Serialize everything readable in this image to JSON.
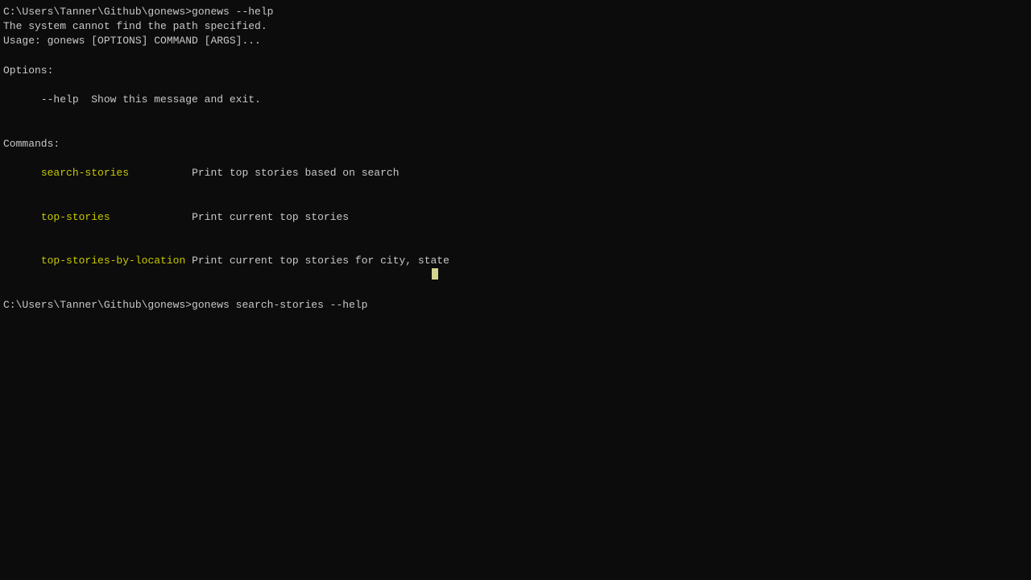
{
  "terminal": {
    "background": "#0c0c0c",
    "lines": [
      {
        "id": "line1",
        "type": "prompt",
        "text": "C:\\Users\\Tanner\\Github\\gonews>gonews --help",
        "color": "white"
      },
      {
        "id": "line2",
        "type": "output",
        "text": "The system cannot find the path specified.",
        "color": "white"
      },
      {
        "id": "line3",
        "type": "output",
        "text": "Usage: gonews [OPTIONS] COMMAND [ARGS]...",
        "color": "white"
      },
      {
        "id": "line4",
        "type": "empty"
      },
      {
        "id": "line5",
        "type": "output",
        "text": "Options:",
        "color": "white"
      },
      {
        "id": "line6",
        "type": "option",
        "flag": "--help",
        "desc": "Show this message and exit.",
        "color": "white"
      },
      {
        "id": "line7",
        "type": "empty"
      },
      {
        "id": "line8",
        "type": "output",
        "text": "Commands:",
        "color": "white"
      },
      {
        "id": "cmd1",
        "type": "command",
        "name": "search-stories",
        "desc": "Print top stories based on search",
        "name_color": "yellow",
        "desc_color": "white"
      },
      {
        "id": "cmd2",
        "type": "command",
        "name": "top-stories",
        "desc": "Print current top stories",
        "name_color": "yellow",
        "desc_color": "white"
      },
      {
        "id": "cmd3",
        "type": "command",
        "name": "top-stories-by-location",
        "desc": "Print current top stories for city, state",
        "name_color": "yellow",
        "desc_color": "white"
      },
      {
        "id": "line9",
        "type": "empty"
      },
      {
        "id": "line10",
        "type": "prompt",
        "text": "C:\\Users\\Tanner\\Github\\gonews>gonews search-stories --help",
        "color": "white"
      }
    ],
    "prompt": {
      "path": "C:\\Users\\Tanner\\Github\\gonews>",
      "cmd1": "gonews --help",
      "cmd2": "gonews search-stories --help"
    },
    "options": {
      "help_flag": "--help",
      "help_desc": "Show this message and exit."
    },
    "commands": {
      "search_stories": {
        "name": "search-stories",
        "desc": "Print top stories based on search"
      },
      "top_stories": {
        "name": "top-stories",
        "desc": "Print current top stories"
      },
      "top_stories_by_location": {
        "name": "top-stories-by-location",
        "desc": "Print current top stories for city, state"
      }
    },
    "error": "The system cannot find the path specified.",
    "usage": "Usage: gonews [OPTIONS] COMMAND [ARGS]...",
    "options_header": "Options:",
    "commands_header": "Commands:"
  }
}
